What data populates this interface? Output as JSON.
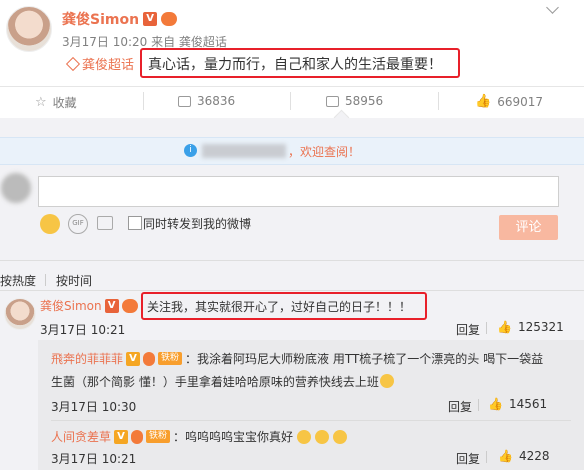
{
  "post": {
    "author": "龚俊Simon",
    "meta": "3月17日 10:20 来自 龚俊超话",
    "topic_tag": "龚俊超话",
    "text": "真心话，量力而行，自己和家人的生活最重要！"
  },
  "actions": {
    "collect": "收藏",
    "repost": "36836",
    "comment": "58956",
    "like": "669017"
  },
  "notice": "，欢迎查阅！",
  "composer": {
    "repost_label": "同时转发到我的微博",
    "submit": "评论"
  },
  "sort_tabs": [
    "按热度",
    "按时间"
  ],
  "comments": [
    {
      "author": "龚俊Simon",
      "text": "关注我，其实就很开心了，过好自己的日子！！！",
      "time": "3月17日 10:21",
      "reply": "回复",
      "likes": "125321"
    }
  ],
  "replies": [
    {
      "author": "飛奔的菲菲菲",
      "fan_badge": "铁粉",
      "text_line1": "：我涂着阿玛尼大师粉底液 用TT梳子梳了一个漂亮的头 喝下一袋益",
      "text_line2": "生菌（那个简影 懂！）手里拿着娃哈哈原味的营养快线去上班",
      "time": "3月17日 10:30",
      "reply": "回复",
      "likes": "14561"
    },
    {
      "author": "人间贪差草",
      "fan_badge": "铁粉",
      "text": "：呜呜呜呜宝宝你真好",
      "time": "3月17日 10:21",
      "reply": "回复",
      "likes": "4228"
    }
  ]
}
